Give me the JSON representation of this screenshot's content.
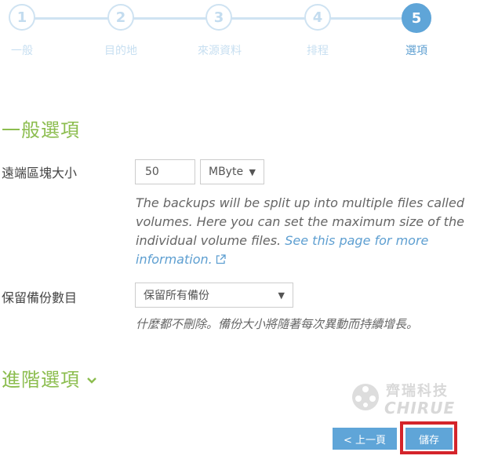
{
  "wizard": {
    "steps": [
      {
        "number": "1",
        "label": "一般"
      },
      {
        "number": "2",
        "label": "目的地"
      },
      {
        "number": "3",
        "label": "來源資料"
      },
      {
        "number": "4",
        "label": "排程"
      },
      {
        "number": "5",
        "label": "選項"
      }
    ],
    "active_step": 5
  },
  "general": {
    "title": "一般選項",
    "remote_volume": {
      "label": "遠端區塊大小",
      "value": "50",
      "unit": "MByte",
      "help_text": [
        "The backups will be split up into multiple files called",
        "volumes. Here you can set the maximum size of the",
        "individual volume files. "
      ],
      "help_link_part1": "See this page for more",
      "help_link_part2": "information."
    },
    "retention": {
      "label": "保留備份數目",
      "value": "保留所有備份",
      "help_text": "什麼都不刪除。備份大小將隨著每次異動而持續增長。"
    }
  },
  "advanced": {
    "title": "進階選項"
  },
  "watermark": {
    "line1": "齊瑞科技",
    "line2": "CHIRUE"
  },
  "buttons": {
    "prev": "< 上一頁",
    "save": "儲存"
  },
  "colors": {
    "accent": "#5fa5d8",
    "section_green": "#8cbd4f",
    "highlight_red": "#d4242b"
  }
}
